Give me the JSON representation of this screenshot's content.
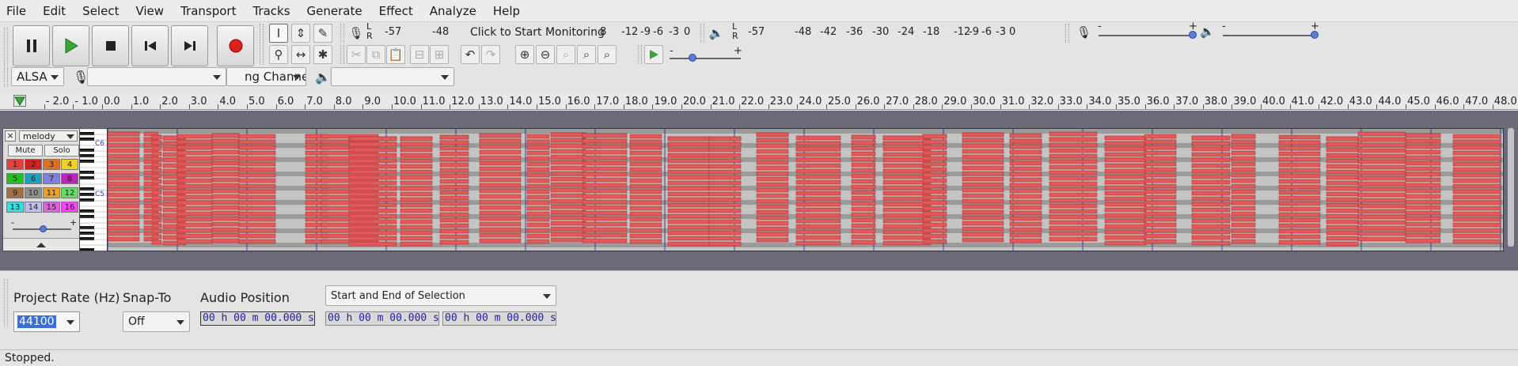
{
  "menu": [
    "File",
    "Edit",
    "Select",
    "View",
    "Transport",
    "Tracks",
    "Generate",
    "Effect",
    "Analyze",
    "Help"
  ],
  "transport": {
    "buttons": [
      {
        "name": "pause-button",
        "icon": "pause-icon"
      },
      {
        "name": "play-button",
        "icon": "play-icon"
      },
      {
        "name": "stop-button",
        "icon": "stop-icon"
      },
      {
        "name": "skip-start-button",
        "icon": "skip-start-icon"
      },
      {
        "name": "skip-end-button",
        "icon": "skip-end-icon"
      },
      {
        "name": "record-button",
        "icon": "record-icon"
      }
    ]
  },
  "record_meter": {
    "l": "L",
    "r": "R",
    "scale": [
      "-57",
      "-48"
    ],
    "prompt": "Click to Start Monitoring",
    "scale_right": [
      "-12",
      "-9",
      "-6",
      "-3",
      "0"
    ],
    "cutoff": "8"
  },
  "playback_meter": {
    "l": "L",
    "r": "R",
    "scale": [
      "-57",
      "-48",
      "-42",
      "-36",
      "-30",
      "-24",
      "-18",
      "-12",
      "-9",
      "-6",
      "-3",
      "0"
    ]
  },
  "mixer": {
    "rec_minus": "-",
    "rec_plus": "+",
    "play_minus": "-",
    "play_plus": "+"
  },
  "play_speed": {
    "minus": "-",
    "plus": "+"
  },
  "device": {
    "host": "ALSA",
    "recording_device": "",
    "channels": "ng Channels",
    "playback_device": ""
  },
  "ruler": {
    "ticks": [
      "- 2.0",
      "- 1.0",
      "0.0",
      "1.0",
      "2.0",
      "3.0",
      "4.0",
      "5.0",
      "6.0",
      "7.0",
      "8.0",
      "9.0",
      "10.0",
      "11.0",
      "12.0",
      "13.0",
      "14.0",
      "15.0",
      "16.0",
      "17.0",
      "18.0",
      "19.0",
      "20.0",
      "21.0",
      "22.0",
      "23.0",
      "24.0",
      "25.0",
      "26.0",
      "27.0",
      "28.0",
      "29.0",
      "30.0",
      "31.0",
      "32.0",
      "33.0",
      "34.0",
      "35.0",
      "36.0",
      "37.0",
      "38.0",
      "39.0",
      "40.0",
      "41.0",
      "42.0",
      "43.0",
      "44.0",
      "45.0",
      "46.0",
      "47.0",
      "48.0"
    ]
  },
  "track": {
    "close": "×",
    "name": "melody",
    "mute": "Mute",
    "solo": "Solo",
    "channels": [
      {
        "n": "1",
        "color": "#e04040"
      },
      {
        "n": "2",
        "color": "#d02020"
      },
      {
        "n": "3",
        "color": "#e07020"
      },
      {
        "n": "4",
        "color": "#f0d020"
      },
      {
        "n": "5",
        "color": "#20c020"
      },
      {
        "n": "6",
        "color": "#20a0c0"
      },
      {
        "n": "7",
        "color": "#8080e0"
      },
      {
        "n": "8",
        "color": "#c020c0"
      },
      {
        "n": "9",
        "color": "#a07040"
      },
      {
        "n": "10",
        "color": "#909090"
      },
      {
        "n": "11",
        "color": "#f0a020"
      },
      {
        "n": "12",
        "color": "#60e060"
      },
      {
        "n": "13",
        "color": "#30e0e0"
      },
      {
        "n": "14",
        "color": "#c0c0f0"
      },
      {
        "n": "15",
        "color": "#e060e0"
      },
      {
        "n": "16",
        "color": "#ff40ff"
      }
    ],
    "vel_minus": "-",
    "vel_plus": "+",
    "octave_labels": [
      "C6",
      "C5"
    ],
    "note_color": "#e05a5a"
  },
  "selection": {
    "project_rate_label": "Project Rate (Hz)",
    "project_rate_value": "44100",
    "snap_label": "Snap-To",
    "snap_value": "Off",
    "audio_position_label": "Audio Position",
    "audio_position_value": "00 h 00 m 00.000 s",
    "selection_mode": "Start and End of Selection",
    "start_value": "00 h 00 m 00.000 s",
    "end_value": "00 h 00 m 00.000 s"
  },
  "status": "Stopped."
}
